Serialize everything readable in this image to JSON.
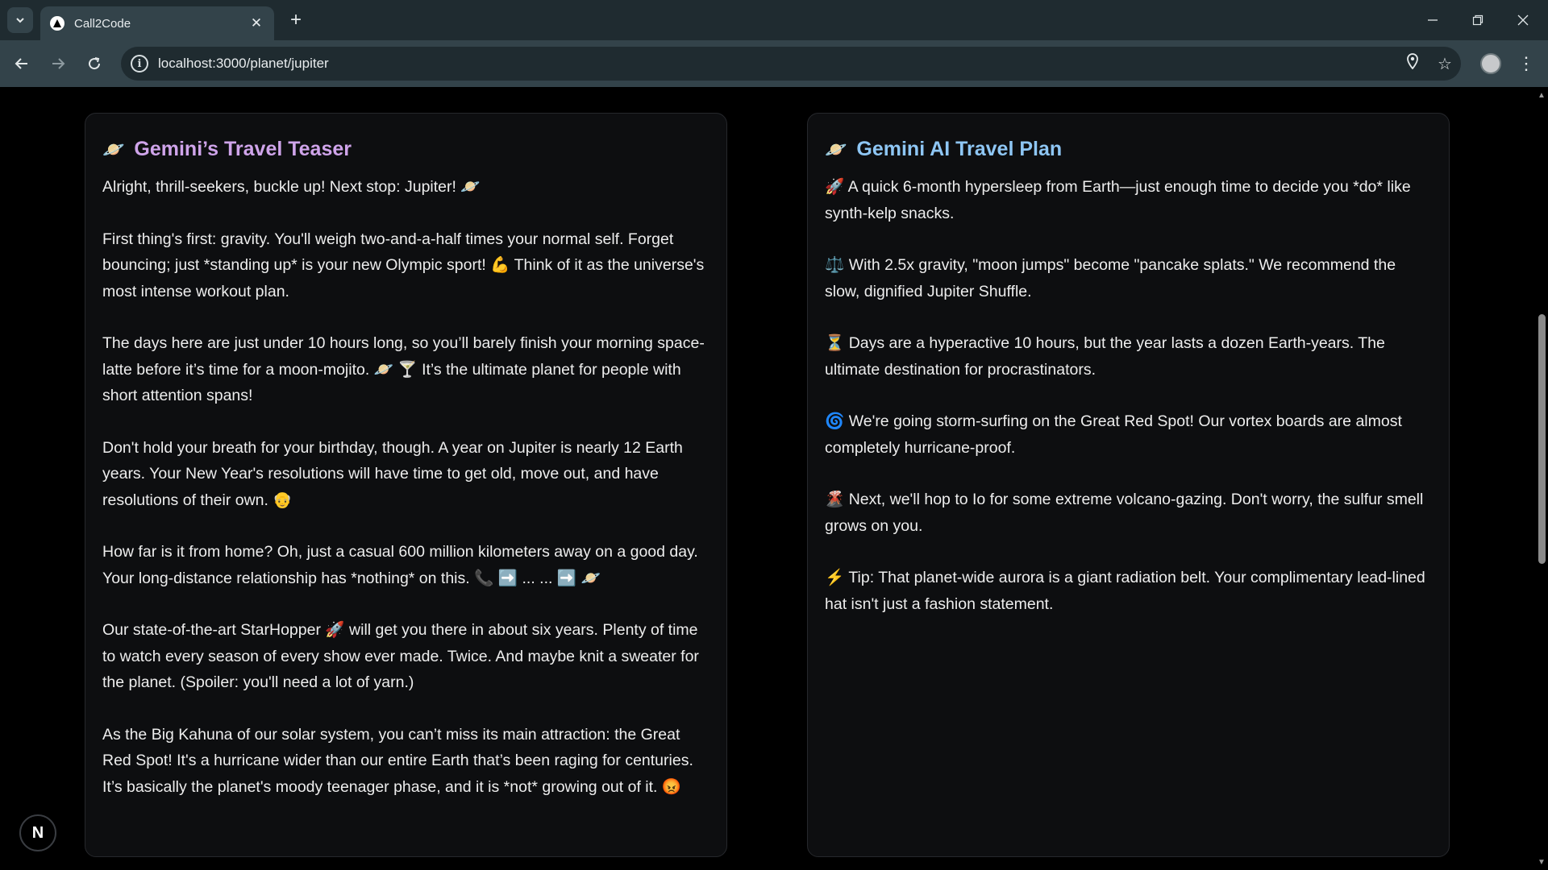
{
  "browser": {
    "tab_title": "Call2Code",
    "url": "localhost:3000/planet/jupiter",
    "icons": {
      "tab_search": "chevron-down-icon",
      "favicon": "triangle-favicon",
      "close": "close-icon",
      "new_tab": "plus-icon",
      "back": "back-arrow-icon",
      "forward": "forward-arrow-icon",
      "reload": "reload-icon",
      "site_info": "info-icon",
      "location": "location-pin-icon",
      "bookmark": "star-icon",
      "menu": "kebab-menu-icon"
    }
  },
  "left_card": {
    "title": "Gemini’s Travel Teaser",
    "title_icon": "🪐",
    "paragraphs": [
      "Alright, thrill-seekers, buckle up! Next stop: Jupiter! 🪐",
      "First thing's first: gravity. You'll weigh two-and-a-half times your normal self. Forget bouncing; just *standing up* is your new Olympic sport! 💪 Think of it as the universe's most intense workout plan.",
      "The days here are just under 10 hours long, so you’ll barely finish your morning space-latte before it’s time for a moon-mojito. 🪐 🍸 It’s the ultimate planet for people with short attention spans!",
      "Don't hold your breath for your birthday, though. A year on Jupiter is nearly 12 Earth years. Your New Year's resolutions will have time to get old, move out, and have resolutions of their own. 👴",
      "How far is it from home? Oh, just a casual 600 million kilometers away on a good day. Your long-distance relationship has *nothing* on this. 📞 ➡️ ... ... ➡️ 🪐",
      "Our state-of-the-art StarHopper 🚀 will get you there in about six years. Plenty of time to watch every season of every show ever made. Twice. And maybe knit a sweater for the planet. (Spoiler: you'll need a lot of yarn.)",
      "As the Big Kahuna of our solar system, you can’t miss its main attraction: the Great Red Spot! It's a hurricane wider than our entire Earth that’s been raging for centuries. It’s basically the planet's moody teenager phase, and it is *not* growing out of it. 😡"
    ]
  },
  "right_card": {
    "title": "Gemini AI Travel Plan",
    "title_icon": "🪐",
    "paragraphs": [
      "🚀 A quick 6-month hypersleep from Earth—just enough time to decide you *do* like synth-kelp snacks.",
      "⚖️ With 2.5x gravity, \"moon jumps\" become \"pancake splats.\" We recommend the slow, dignified Jupiter Shuffle.",
      "⏳ Days are a hyperactive 10 hours, but the year lasts a dozen Earth-years. The ultimate destination for procrastinators.",
      "🌀 We're going storm-surfing on the Great Red Spot! Our vortex boards are almost completely hurricane-proof.",
      "🌋 Next, we'll hop to Io for some extreme volcano-gazing. Don't worry, the sulfur smell grows on you.",
      "⚡ Tip: That planet-wide aurora is a giant radiation belt. Your complimentary lead-lined hat isn't just a fashion statement."
    ]
  },
  "dev_badge": "N"
}
